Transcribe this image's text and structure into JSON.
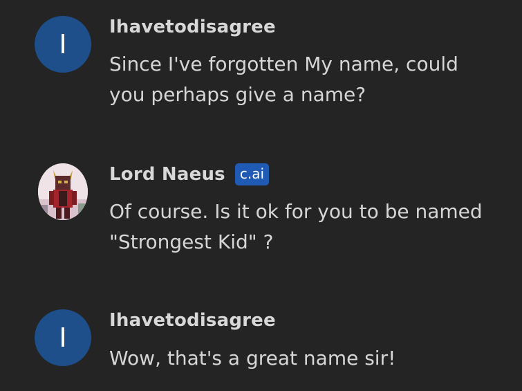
{
  "messages": [
    {
      "author": "Ihavetodisagree",
      "avatar_initial": "I",
      "text": "Since I've forgotten My name, could you perhaps give a name?"
    },
    {
      "author": "Lord Naeus",
      "badge": "c.ai",
      "text": "Of course. Is it ok for you to be named \"Strongest Kid\" ?"
    },
    {
      "author": "Ihavetodisagree",
      "avatar_initial": "I",
      "text": "Wow, that's a great name sir!"
    }
  ],
  "colors": {
    "background": "#242424",
    "user_avatar": "#1e4f8a",
    "badge": "#1f5bb5",
    "text": "#d6d6d6"
  }
}
